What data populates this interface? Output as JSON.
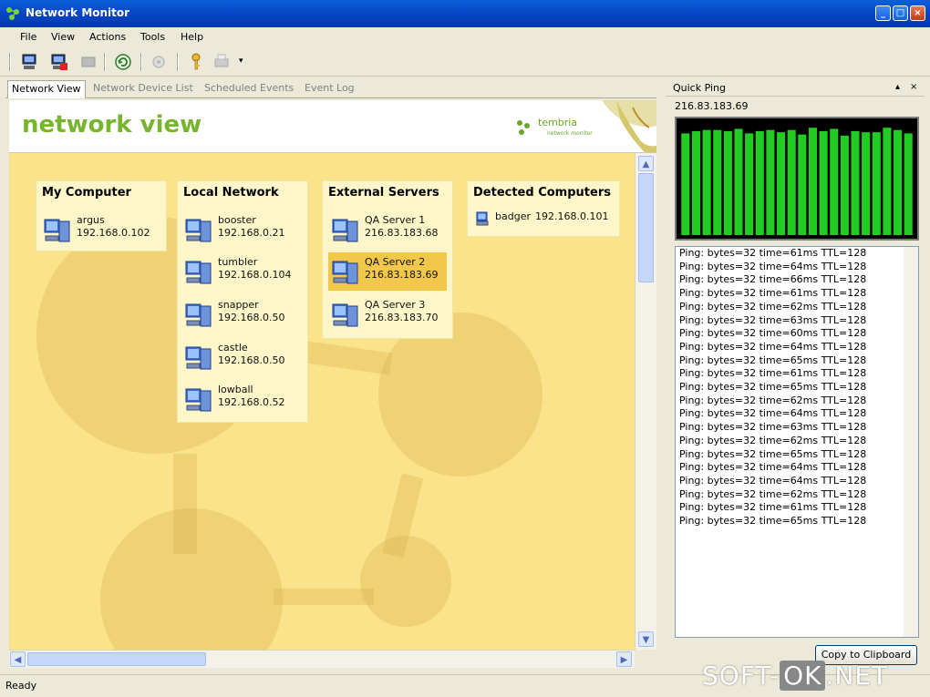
{
  "window": {
    "title": "Network Monitor"
  },
  "menu": [
    "File",
    "View",
    "Actions",
    "Tools",
    "Help"
  ],
  "tabs": [
    "Network View",
    "Network Device List",
    "Scheduled Events",
    "Event Log"
  ],
  "header": {
    "title": "network view",
    "logo_text": "tembria",
    "logo_sub": "network monitor"
  },
  "groups": [
    {
      "title": "My Computer",
      "nodes": [
        {
          "name": "argus",
          "ip": "192.168.0.102"
        }
      ]
    },
    {
      "title": "Local Network",
      "nodes": [
        {
          "name": "booster",
          "ip": "192.168.0.21"
        },
        {
          "name": "tumbler",
          "ip": "192.168.0.104"
        },
        {
          "name": "snapper",
          "ip": "192.168.0.50"
        },
        {
          "name": "castle",
          "ip": "192.168.0.50"
        },
        {
          "name": "lowball",
          "ip": "192.168.0.52"
        }
      ]
    },
    {
      "title": "External Servers",
      "nodes": [
        {
          "name": "QA Server 1",
          "ip": "216.83.183.68"
        },
        {
          "name": "QA Server 2",
          "ip": "216.83.183.69",
          "selected": true
        },
        {
          "name": "QA Server 3",
          "ip": "216.83.183.70"
        }
      ]
    },
    {
      "title": "Detected Computers",
      "nodes": [
        {
          "name": "badger",
          "ip": "192.168.0.101"
        }
      ]
    }
  ],
  "quick_ping": {
    "title": "Quick Ping",
    "pin": "▴",
    "close": "×",
    "ip": "216.83.183.69",
    "log": [
      "Ping: bytes=32 time=61ms TTL=128",
      "Ping: bytes=32 time=64ms TTL=128",
      "Ping: bytes=32 time=66ms TTL=128",
      "Ping: bytes=32 time=61ms TTL=128",
      "Ping: bytes=32 time=62ms TTL=128",
      "Ping: bytes=32 time=63ms TTL=128",
      "Ping: bytes=32 time=60ms TTL=128",
      "Ping: bytes=32 time=64ms TTL=128",
      "Ping: bytes=32 time=65ms TTL=128",
      "Ping: bytes=32 time=61ms TTL=128",
      "Ping: bytes=32 time=65ms TTL=128",
      "Ping: bytes=32 time=62ms TTL=128",
      "Ping: bytes=32 time=64ms TTL=128",
      "Ping: bytes=32 time=63ms TTL=128",
      "Ping: bytes=32 time=62ms TTL=128",
      "Ping: bytes=32 time=65ms TTL=128",
      "Ping: bytes=32 time=64ms TTL=128",
      "Ping: bytes=32 time=64ms TTL=128",
      "Ping: bytes=32 time=62ms TTL=128",
      "Ping: bytes=32 time=61ms TTL=128",
      "Ping: bytes=32 time=65ms TTL=128"
    ],
    "copy_button": "Copy to Clipboard"
  },
  "chart_data": {
    "type": "bar",
    "values": [
      0.9,
      0.92,
      0.93,
      0.93,
      0.92,
      0.94,
      0.9,
      0.92,
      0.93,
      0.91,
      0.93,
      0.89,
      0.95,
      0.92,
      0.94,
      0.88,
      0.92,
      0.91,
      0.91,
      0.95,
      0.93,
      0.9
    ],
    "ylim": [
      0,
      1
    ],
    "colors": {
      "bar": "#22cc22",
      "background": "#000000"
    }
  },
  "status": {
    "text": "Ready"
  },
  "watermark": {
    "left": "SOFT-",
    "ok": "OK",
    "right": ".NET"
  }
}
